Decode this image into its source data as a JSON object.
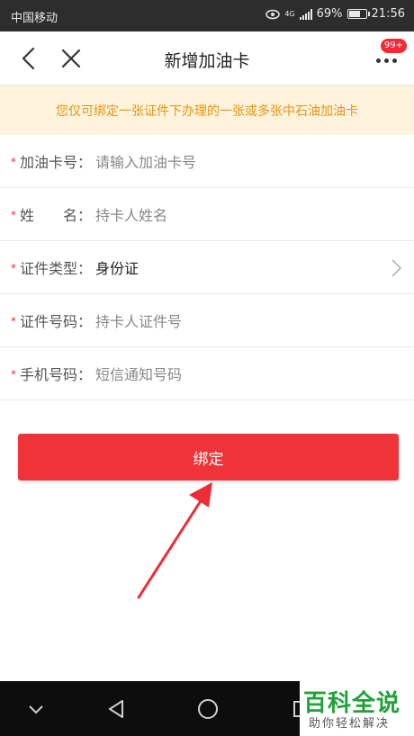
{
  "status_bar": {
    "carrier": "中国移动",
    "network": "4G",
    "battery": "69%",
    "battery_level": 0.69,
    "time": "21:56"
  },
  "navbar": {
    "title": "新增加油卡",
    "badge": "99+"
  },
  "notice": "您仅可绑定一张证件下办理的一张或多张中石油加油卡",
  "form": {
    "rows": [
      {
        "label": "加油卡号",
        "sep": "：",
        "value": "请输入加油卡号",
        "filled": false
      },
      {
        "label": "姓　　名",
        "sep": "：",
        "value": "持卡人姓名",
        "filled": false
      },
      {
        "label": "证件类型",
        "sep": "：",
        "value": "身份证",
        "filled": true
      },
      {
        "label": "证件号码",
        "sep": "：",
        "value": "持卡人证件号",
        "filled": false
      },
      {
        "label": "手机号码",
        "sep": "：",
        "value": "短信通知号码",
        "filled": false
      }
    ]
  },
  "bind_button": "绑定",
  "watermark": {
    "title": "百科全说",
    "subtitle": "助你轻松解决"
  },
  "colors": {
    "accent": "#ef3338",
    "notice_bg": "#fdf3dc",
    "notice_text": "#e8940f",
    "watermark": "#21a13a"
  },
  "icons": {
    "back": "chevron-left-icon",
    "close": "close-icon",
    "more": "more-dots-icon",
    "row_arrow": "chevron-right-icon",
    "sys_back": "triangle-back-icon",
    "sys_home": "circle-home-icon",
    "sys_recent": "square-recent-icon",
    "sys_down": "chevron-down-icon"
  }
}
